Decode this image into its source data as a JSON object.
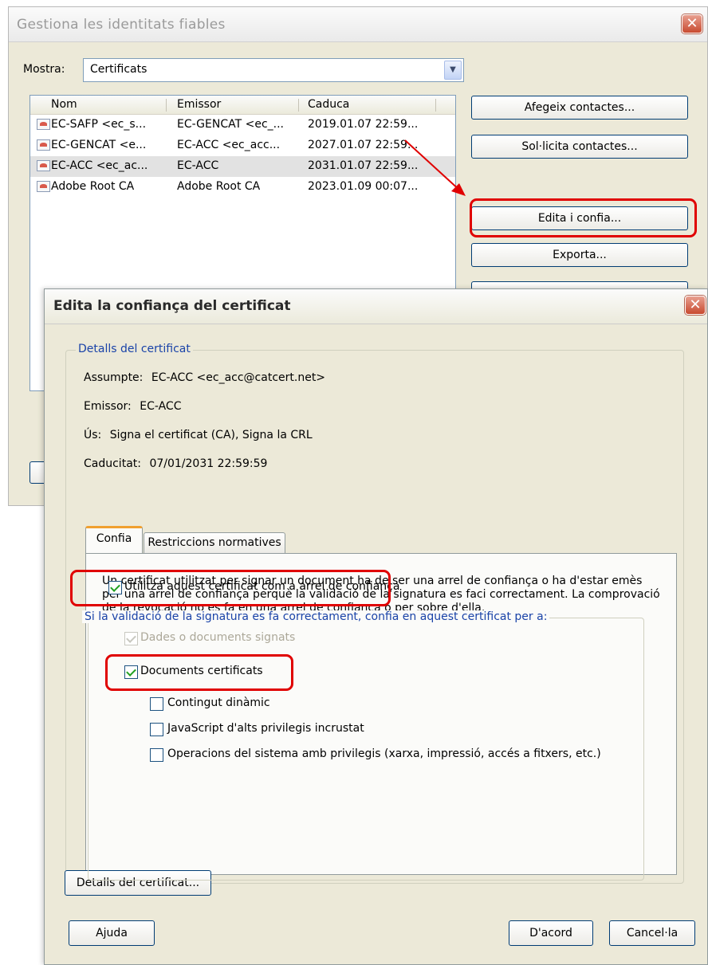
{
  "back_window": {
    "title": "Gestiona les identitats fiables",
    "show_label": "Mostra:",
    "show_value": "Certificats",
    "columns": [
      "Nom",
      "Emissor",
      "Caduca"
    ],
    "rows": [
      {
        "name": "EC-SAFP <ec_s...",
        "issuer": "EC-GENCAT <ec_...",
        "expires": "2019.01.07 22:59..."
      },
      {
        "name": "EC-GENCAT <e...",
        "issuer": "EC-ACC <ec_acc...",
        "expires": "2027.01.07 22:59..."
      },
      {
        "name": "EC-ACC <ec_ac...",
        "issuer": "EC-ACC",
        "expires": "2031.01.07 22:59..."
      },
      {
        "name": "Adobe Root CA",
        "issuer": "Adobe Root CA",
        "expires": "2023.01.09 00:07..."
      }
    ],
    "buttons": {
      "add": "Afegeix contactes...",
      "request": "Sol·licita contactes...",
      "edit": "Edita i confia...",
      "export": "Exporta..."
    },
    "close_glyph": "✕"
  },
  "dialog": {
    "title": "Edita la confiança del certificat",
    "details_legend": "Detalls del certificat",
    "subject_label": "Assumpte:",
    "subject_value": "EC-ACC <ec_acc@catcert.net>",
    "issuer_label": "Emissor:",
    "issuer_value": "EC-ACC",
    "usage_label": "Ús:",
    "usage_value": "Signa el certificat (CA), Signa la CRL",
    "expiry_label": "Caducitat:",
    "expiry_value": "07/01/2031 22:59:59",
    "tabs": [
      "Confia",
      "Restriccions normatives"
    ],
    "description": "Un certificat utilitzat per signar un document ha de ser una arrel de confiança o ha d'estar emès per una arrel de confiança perquè la validació de la signatura es faci correctament. La comprovació de la revocació no es fa en una arrel de confiança o per sobre d'ella.",
    "root_checkbox": "Utilitza aquest certificat com a arrel de confiança",
    "inner_legend": "Si la validació de la signatura es fa correctament, confia en aquest certificat per a:",
    "options": [
      {
        "label": "Dades o documents signats",
        "checked": true,
        "disabled": true
      },
      {
        "label": "Documents certificats",
        "checked": true,
        "disabled": false
      },
      {
        "label": "Contingut dinàmic",
        "checked": false,
        "disabled": false
      },
      {
        "label": "JavaScript d'alts privilegis incrustat",
        "checked": false,
        "disabled": false
      },
      {
        "label": "Operacions del sistema amb privilegis (xarxa, impressió, accés a fitxers, etc.)",
        "checked": false,
        "disabled": false
      }
    ],
    "cert_details_button": "Detalls del certificat...",
    "help_button": "Ajuda",
    "ok_button": "D'acord",
    "cancel_button": "Cancel·la",
    "close_glyph": "✕"
  },
  "colors": {
    "highlight": "#e00000",
    "legend": "#1a43a8"
  }
}
